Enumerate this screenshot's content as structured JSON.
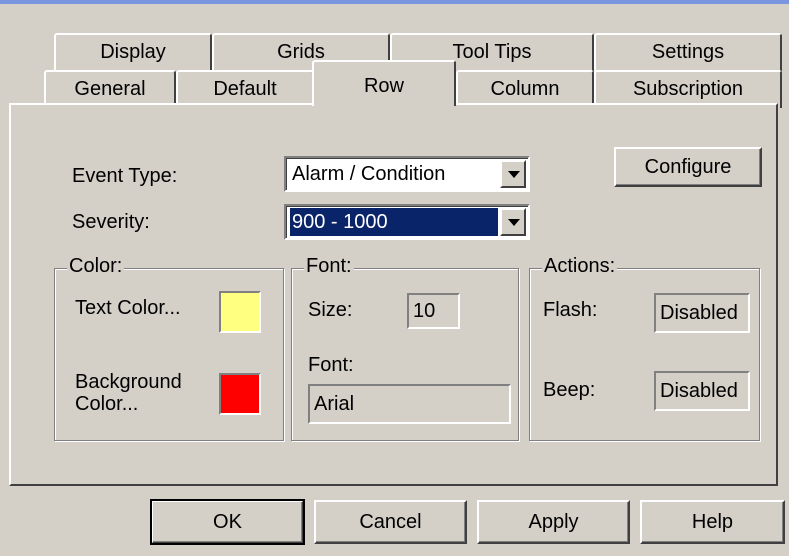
{
  "tabs_back": [
    "Display",
    "Grids",
    "Tool Tips",
    "Settings"
  ],
  "tabs_front": [
    "General",
    "Default",
    "Row",
    "Column",
    "Subscription"
  ],
  "active_tab": "Row",
  "event_type": {
    "label": "Event Type:",
    "value": "Alarm / Condition"
  },
  "severity": {
    "label": "Severity:",
    "value": "900 - 1000"
  },
  "configure_label": "Configure",
  "color_group": {
    "title": "Color:",
    "text_color_label": "Text Color...",
    "text_color": "#ffff80",
    "background_label_1": "Background",
    "background_label_2": "Color...",
    "background_color": "#ff0000"
  },
  "font_group": {
    "title": "Font:",
    "size_label": "Size:",
    "size_value": "10",
    "font_label": "Font:",
    "font_value": "Arial"
  },
  "actions_group": {
    "title": "Actions:",
    "flash_label": "Flash:",
    "flash_value": "Disabled",
    "beep_label": "Beep:",
    "beep_value": "Disabled"
  },
  "buttons": {
    "ok": "OK",
    "cancel": "Cancel",
    "apply": "Apply",
    "help": "Help"
  }
}
